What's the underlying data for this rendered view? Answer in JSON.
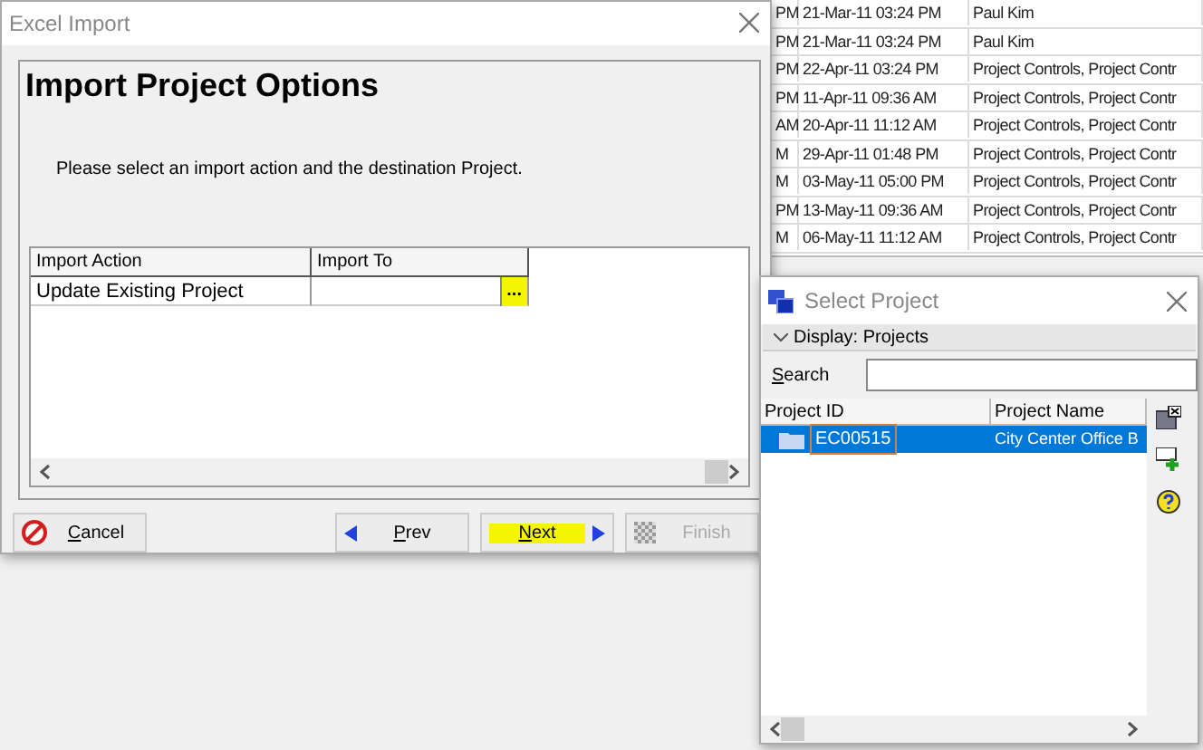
{
  "background_table": {
    "rows": [
      {
        "column_1": "PM",
        "column_2": "21-Mar-11 03:24 PM",
        "column_3": "Paul Kim"
      },
      {
        "column_1": "PM",
        "column_2": "21-Mar-11 03:24 PM",
        "column_3": "Paul Kim"
      },
      {
        "column_1": "PM",
        "column_2": "22-Apr-11 03:24 PM",
        "column_3": "Project Controls, Project Contr"
      },
      {
        "column_1": "PM",
        "column_2": "11-Apr-11 09:36 AM",
        "column_3": "Project Controls, Project Contr"
      },
      {
        "column_1": "AM",
        "column_2": "20-Apr-11 11:12 AM",
        "column_3": "Project Controls, Project Contr"
      },
      {
        "column_1": "M",
        "column_2": "29-Apr-11 01:48 PM",
        "column_3": "Project Controls, Project Contr"
      },
      {
        "column_1": "M",
        "column_2": "03-May-11 05:00 PM",
        "column_3": "Project Controls, Project Contr"
      },
      {
        "column_1": "PM",
        "column_2": "13-May-11 09:36 AM",
        "column_3": "Project Controls, Project Contr"
      },
      {
        "column_1": "M",
        "column_2": "06-May-11 11:12 AM",
        "column_3": "Project Controls, Project Contr"
      }
    ]
  },
  "import_dialog": {
    "title": "Excel Import",
    "heading": "Import Project Options",
    "instruction": "Please select an import action and the destination Project.",
    "grid": {
      "columns": [
        "Import Action",
        "Import To"
      ],
      "rows": [
        {
          "import_action": "Update Existing Project",
          "import_to": "",
          "browse_button": {
            "label": "...",
            "highlighted": true
          }
        }
      ]
    },
    "buttons": [
      {
        "kind": "cancel",
        "label": "Cancel",
        "disabled": false,
        "highlighted": false
      },
      {
        "kind": "prev",
        "label": "Prev",
        "disabled": false,
        "highlighted": false
      },
      {
        "kind": "next",
        "label": "Next",
        "disabled": false,
        "highlighted": true
      },
      {
        "kind": "finish",
        "label": "Finish",
        "disabled": true,
        "highlighted": false
      }
    ]
  },
  "select_project_dialog": {
    "title": "Select Project",
    "display": "Display: Projects",
    "search_label": "Search",
    "table": {
      "columns": [
        "Project ID",
        "Project Name"
      ],
      "rows": [
        {
          "project_id": "EC00515",
          "project_name": "City Center Office B",
          "selected": true
        }
      ]
    }
  }
}
